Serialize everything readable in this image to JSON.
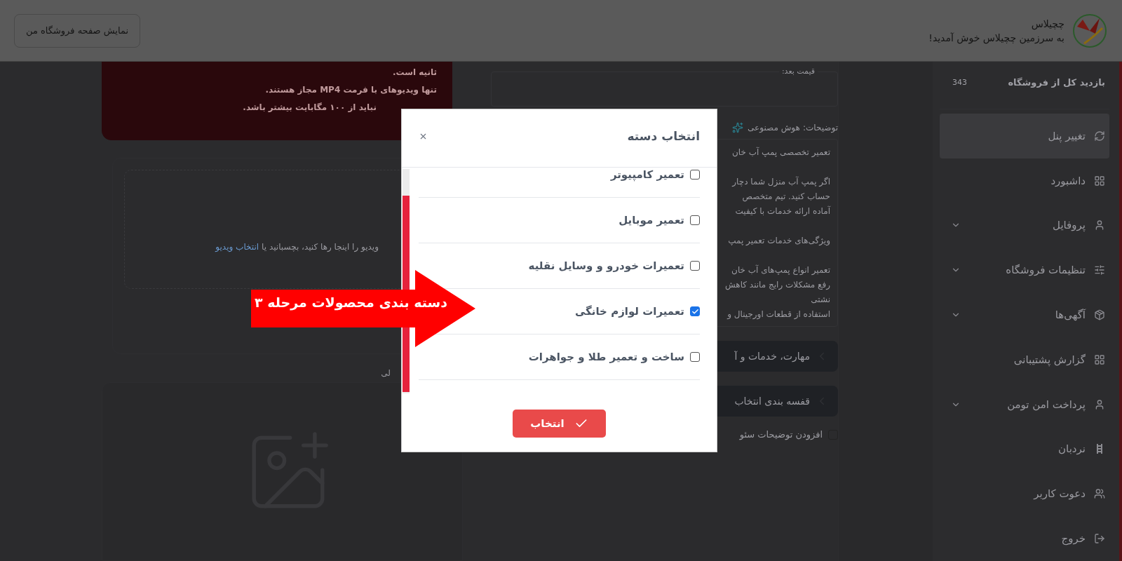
{
  "header": {
    "brand": "چچیلاس",
    "tagline": "به سرزمین چچیلاس خوش آمدید!",
    "store_button": "نمایش صفحه فروشگاه من"
  },
  "sidebar": {
    "stat": {
      "label": "بازدید کل از فروشگاه",
      "value": "343"
    },
    "items": [
      {
        "label": "تغییر پنل",
        "collapsible": false,
        "selected": true
      },
      {
        "label": "داشبورد",
        "collapsible": false,
        "selected": false
      },
      {
        "label": "پروفایل",
        "collapsible": true,
        "selected": false
      },
      {
        "label": "تنظیمات فروشگاه",
        "collapsible": true,
        "selected": false
      },
      {
        "label": "آگهی‌ها",
        "collapsible": true,
        "selected": false
      },
      {
        "label": "گزارش پشتیبانی",
        "collapsible": false,
        "selected": false
      },
      {
        "label": "پرداخت امن تومن",
        "collapsible": true,
        "selected": false
      },
      {
        "label": "نردبان",
        "collapsible": false,
        "selected": false
      },
      {
        "label": "دعوت کاربر",
        "collapsible": false,
        "selected": false
      },
      {
        "label": "خروج",
        "collapsible": false,
        "selected": false
      }
    ]
  },
  "product_form": {
    "price_field": {
      "label": "قیمت بعد:"
    },
    "description": {
      "label": "توضیحات:",
      "ai_button": "هوش مصنوعی",
      "paragraphs": [
        [
          "تعمیر تخصصی پمپ آب خان"
        ],
        [
          "اگر پمپ آب منزل شما دچار",
          "حساب کنید. تیم متخصص",
          "آماده ارائه خدمات با کیفیت"
        ],
        [
          "ویژگی‌های خدمات تعمیر پمپ"
        ],
        [
          "تعمیر انواع پمپ‌های آب خان",
          "رفع مشکلات رایج مانند کاهش",
          "نشتی",
          "استفاده از قطعات اورجینال و"
        ]
      ]
    },
    "sections": [
      "مهارت، خدمات و آ",
      "قفسه بندی انتخاب"
    ],
    "seo_option": {
      "label": "افزودن توضیحات سئو",
      "checked": false
    }
  },
  "video_upload": {
    "notice_lines": [
      "ثانیه است.",
      "تنها ویدیوهای با فرمت MP4 مجاز هستند.",
      "نباید از ۱۰۰ مگابایت بیشتر باشد."
    ],
    "drop_text": "ویدیو را اینجا رها کنید، بچسبانید یا",
    "drop_link": "انتخاب ویدیو"
  },
  "image_upload": {
    "label": "لی"
  },
  "dialog": {
    "title": "انتخاب دسته",
    "categories": [
      {
        "label": "تعمیر کامپیوتر",
        "checked": false
      },
      {
        "label": "تعمیر موبایل",
        "checked": false
      },
      {
        "label": "تعمیرات خودرو و وسایل نقلیه",
        "checked": false
      },
      {
        "label": "تعمیرات لوازم خانگی",
        "checked": true
      },
      {
        "label": "ساخت و تعمیر طلا و جواهرات",
        "checked": false
      }
    ],
    "confirm_button": "انتخاب"
  },
  "annotation": {
    "text": "دسته بندی محصولات مرحله ۳"
  }
}
